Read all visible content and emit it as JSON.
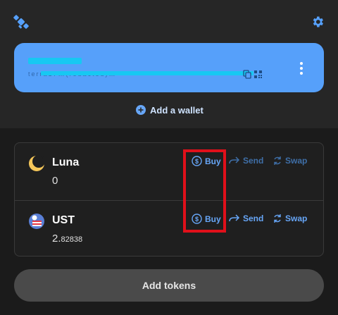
{
  "app": {
    "logo_icon": "satellite-icon",
    "settings_icon": "gear-icon",
    "accent_color": "#56a0fa"
  },
  "wallet_card": {
    "name": "",
    "address": "terra17…(redacted)…",
    "copy_icon": "copy-icon",
    "qr_icon": "qr-code-icon",
    "more_icon": "more-vertical-icon"
  },
  "add_wallet": {
    "label": "Add a wallet",
    "icon": "plus-circle-icon"
  },
  "tokens": [
    {
      "symbol": "Luna",
      "balance_int": "0",
      "balance_dec": "",
      "icon": "luna-moon-icon",
      "actions": {
        "buy": "Buy",
        "send": "Send",
        "swap": "Swap"
      }
    },
    {
      "symbol": "UST",
      "balance_int": "2.",
      "balance_dec": "82838",
      "icon": "ust-globe-icon",
      "actions": {
        "buy": "Buy",
        "send": "Send",
        "swap": "Swap"
      }
    }
  ],
  "add_tokens_label": "Add tokens"
}
